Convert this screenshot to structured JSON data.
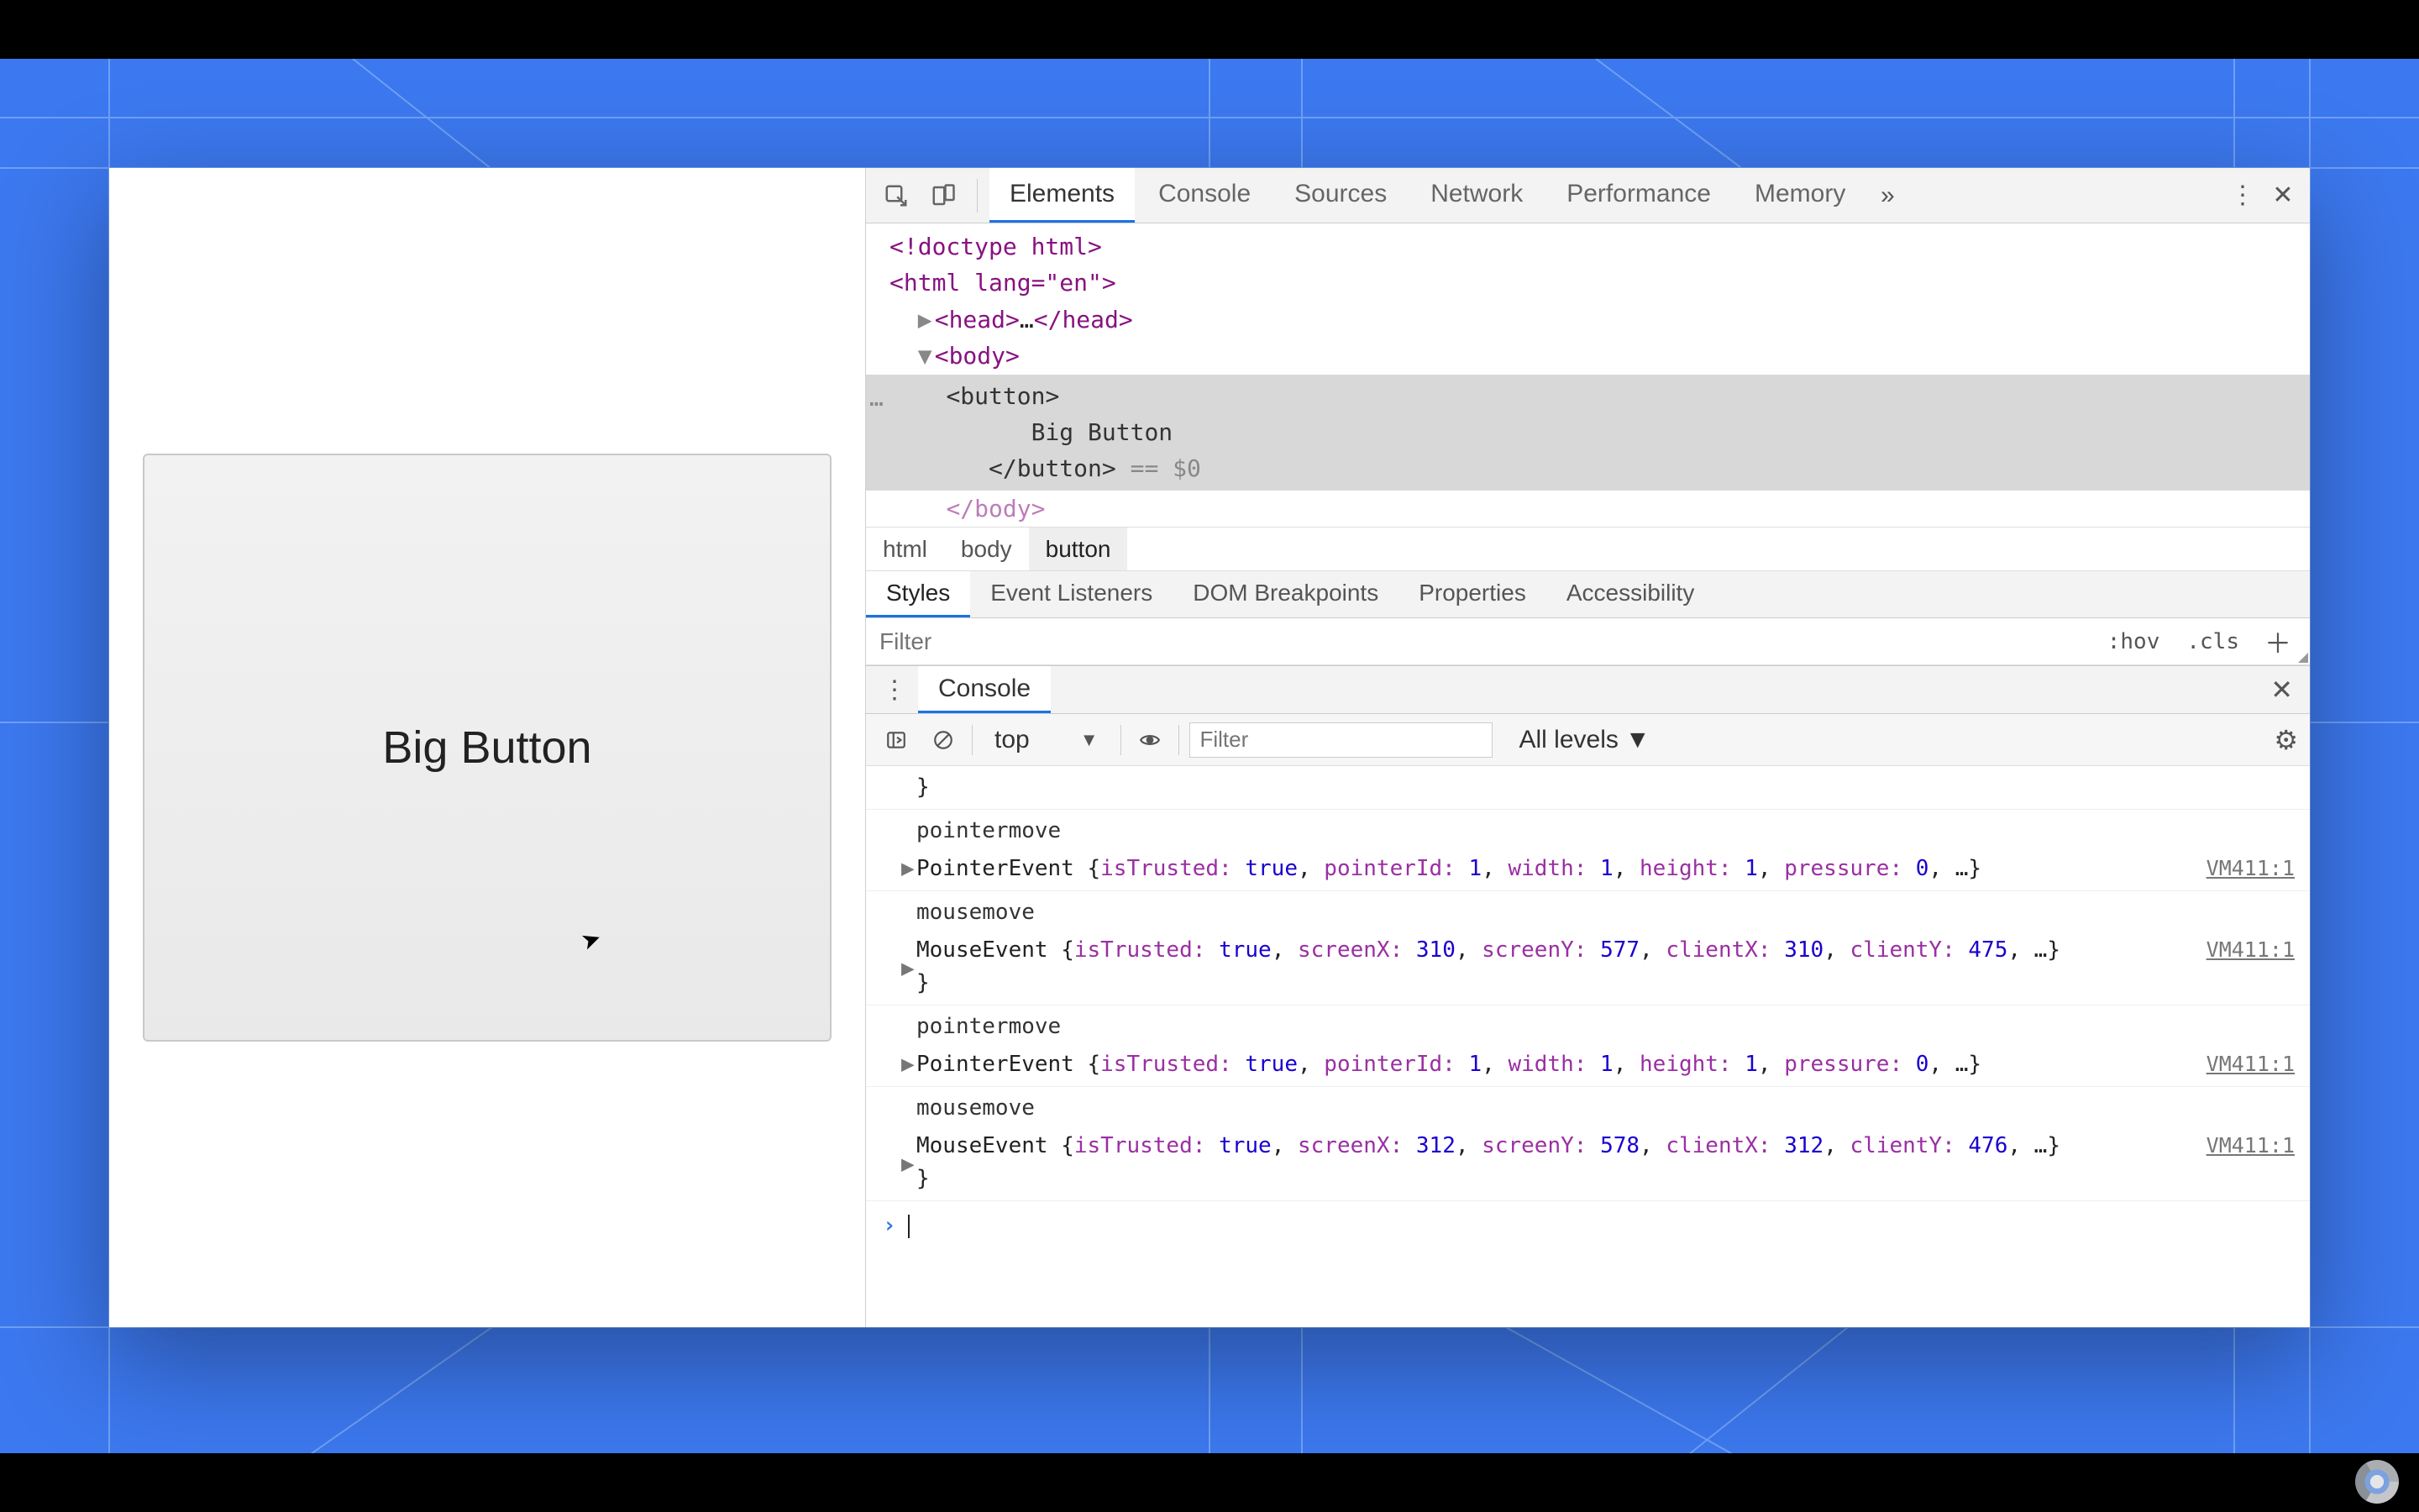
{
  "preview": {
    "button_label": "Big Button"
  },
  "devtools": {
    "tabs": {
      "elements": "Elements",
      "console": "Console",
      "sources": "Sources",
      "network": "Network",
      "performance": "Performance",
      "memory": "Memory"
    },
    "dom_source": {
      "doctype": "<!doctype html>",
      "html_open": "<html lang=\"en\">",
      "head_collapsed_pre": "<head>",
      "head_collapsed_ell": "…",
      "head_collapsed_post": "</head>",
      "body_open": "<body>",
      "button_open": "<button>",
      "button_text": "Big Button",
      "button_close": "</button>",
      "eq0": " == $0",
      "body_close_partial": "</body>"
    },
    "breadcrumbs": [
      "html",
      "body",
      "button"
    ],
    "styles_tabs": {
      "styles": "Styles",
      "event_listeners": "Event Listeners",
      "dom_breakpoints": "DOM Breakpoints",
      "properties": "Properties",
      "accessibility": "Accessibility"
    },
    "styles_filter_placeholder": "Filter",
    "styles_hov": ":hov",
    "styles_cls": ".cls",
    "console_drawer_label": "Console",
    "console_toolbar": {
      "context": "top",
      "filter_placeholder": "Filter",
      "levels": "All levels"
    },
    "log_source": "VM411:1",
    "logs": [
      {
        "brace_only": "}"
      },
      {
        "label": "pointermove",
        "obj_type": "PointerEvent",
        "props": "{isTrusted: true, pointerId: 1, width: 1, height: 1, pressure: 0, …}"
      },
      {
        "label": "mousemove",
        "obj_type": "MouseEvent",
        "props": "{isTrusted: true, screenX: 310, screenY: 577, clientX: 310, clientY: 475, …}",
        "trailing_brace": "}"
      },
      {
        "label": "pointermove",
        "obj_type": "PointerEvent",
        "props": "{isTrusted: true, pointerId: 1, width: 1, height: 1, pressure: 0, …}"
      },
      {
        "label": "mousemove",
        "obj_type": "MouseEvent",
        "props": "{isTrusted: true, screenX: 312, screenY: 578, clientX: 312, clientY: 476, …}",
        "trailing_brace": "}"
      }
    ]
  }
}
